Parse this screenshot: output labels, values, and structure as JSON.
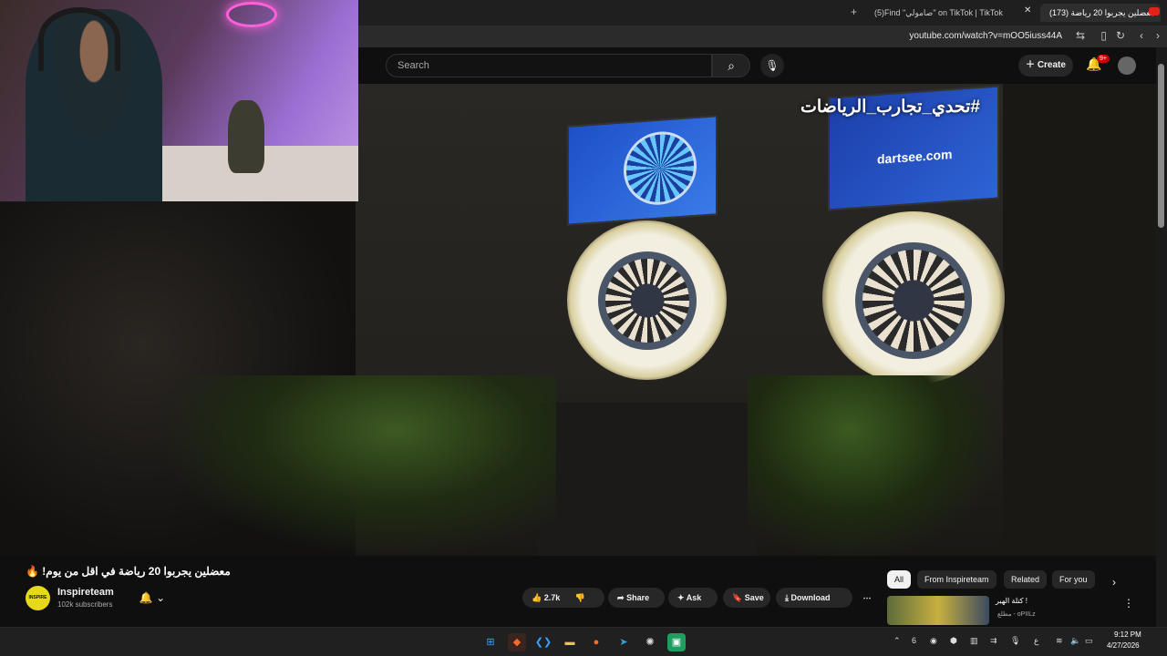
{
  "browser": {
    "tabs": [
      {
        "label": "(173) معضلين يجربوا 20 رياضة",
        "active": true
      },
      {
        "label": "(5)Find \"صامولي\" on TikTok | TikTok",
        "active": false
      }
    ],
    "new_tab_glyph": "+",
    "close_glyph": "✕",
    "url": "youtube.com/watch?v=mOO5iuss44A"
  },
  "youtube": {
    "search_placeholder": "Search",
    "create_label": "Create",
    "notif_badge": "9+",
    "overlay_hashtag": "#تحدي_تجارب_الرياضات",
    "video_title": "🔥 !معضلين يجربوا 20 رياضة في اقل من يوم",
    "channel": {
      "avatar_text": "INSPIRE",
      "name": "Inspireteam",
      "subs": "102k subscribers"
    },
    "actions": {
      "like": "2.7k",
      "share": "Share",
      "ask": "Ask",
      "save": "Save",
      "download": "Download",
      "more": "⋯"
    },
    "chips": [
      "All",
      "From Inspireteam",
      "Related",
      "For you"
    ],
    "recommendation": {
      "title": "كتلة الهبر !",
      "channel": "مطلع - oPIILz"
    },
    "screen_logo": "dartsee.com"
  },
  "taskbar": {
    "time": "9:12 PM",
    "date": "4/27/2026",
    "lang": "ع"
  },
  "colors": {
    "accent": "#cc0000",
    "background": "#0f0f0f",
    "chip_active": "#f1f1f1"
  }
}
